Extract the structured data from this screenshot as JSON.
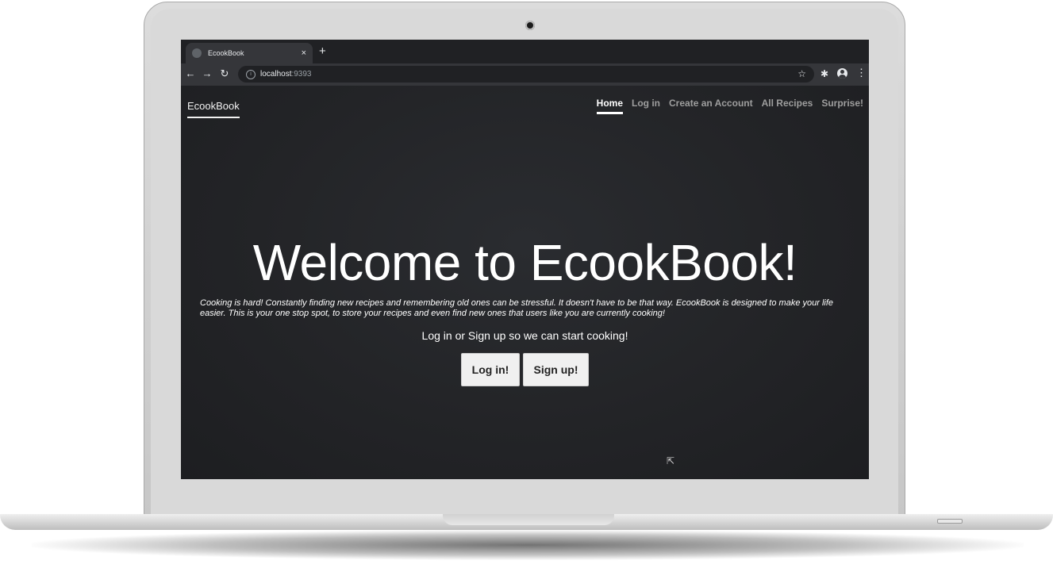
{
  "browser": {
    "tab_title": "EcookBook",
    "tab_close": "×",
    "new_tab": "+",
    "url_host": "localhost",
    "url_port": ":9393",
    "back": "←",
    "forward": "→",
    "reload": "↻",
    "info": "i",
    "star": "☆",
    "extensions": "✱",
    "menu": "⋮"
  },
  "navbar": {
    "brand": "EcookBook",
    "links": [
      "Home",
      "Log in",
      "Create an Account",
      "All Recipes",
      "Surprise!"
    ],
    "active_link": "Home"
  },
  "hero": {
    "title": "Welcome to EcookBook!",
    "lead": "Cooking is hard! Constantly finding new recipes and remembering old ones can be stressful. It doesn't have to be that way. EcookBook is designed to make your life easier. This is your one stop spot, to store your recipes and even find new ones that users like you are currently cooking!",
    "cta_text": "Log in or Sign up so we can start cooking!",
    "login_button": "Log in!",
    "signup_button": "Sign up!"
  },
  "colors": {
    "page_background": "#232427",
    "browser_chrome": "#35363a",
    "nav_inactive": "#9e9e9e",
    "nav_active": "#ffffff",
    "button_background": "#f0f0f0"
  },
  "icons": {
    "camera": "camera-icon",
    "cursor": "mouse-cursor-icon",
    "cursor_glyph": "⇱"
  }
}
